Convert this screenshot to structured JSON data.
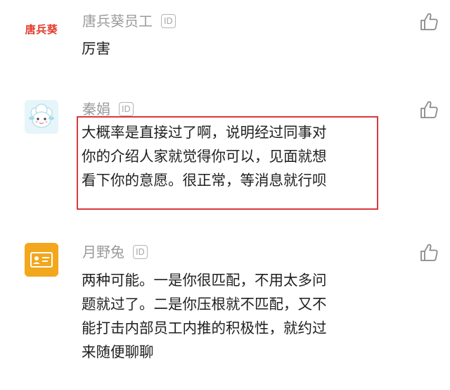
{
  "comments": [
    {
      "author": "唐兵葵员工",
      "badge": "ID",
      "avatar_text": "唐兵葵",
      "text": "厉害"
    },
    {
      "author": "秦娟",
      "badge": "ID",
      "text": "大概率是直接过了啊，说明经过同事对\n你的介绍人家就觉得你可以，见面就想\n看下你的意愿。很正常，等消息就行呗"
    },
    {
      "author": "月野兔",
      "badge": "ID",
      "text": "两种可能。一是你很匹配，不用太多问\n题就过了。二是你压根就不匹配，又不\n能打击内部员工内推的积极性，就约过\n来随便聊聊"
    }
  ],
  "colors": {
    "highlight_border": "#d9393d",
    "author_gray": "#9b9b9b",
    "brand_red": "#e23b2c",
    "avatar3_orange": "#f3a71d"
  },
  "icons": {
    "like": "thumbs-up-icon",
    "avatar2": "sheep-avatar-icon",
    "avatar3": "id-card-icon"
  }
}
